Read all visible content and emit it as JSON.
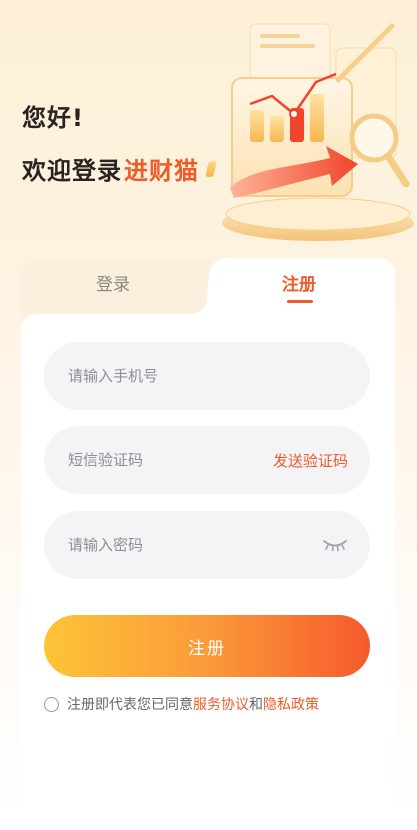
{
  "greeting": {
    "line1": "您好!",
    "line2_prefix": "欢迎登录",
    "brand": "进财猫"
  },
  "tabs": {
    "login": "登录",
    "register": "注册",
    "active": "register"
  },
  "form": {
    "phone_placeholder": "请输入手机号",
    "code_placeholder": "短信验证码",
    "send_code_label": "发送验证码",
    "password_placeholder": "请输入密码",
    "submit_label": "注册"
  },
  "agreement": {
    "prefix": "注册即代表您已同意",
    "service_link": "服务协议",
    "and": "和",
    "privacy_link": "隐私政策",
    "checked": false
  },
  "icons": {
    "password_toggle": "eye-closed-icon",
    "checkbox": "radio-circle-icon"
  },
  "colors": {
    "accent": "#f05a28",
    "button_gradient_start": "#fdc437",
    "button_gradient_end": "#f55a2c",
    "field_bg": "#f4f4f6",
    "background_top": "#fdf0d6"
  }
}
